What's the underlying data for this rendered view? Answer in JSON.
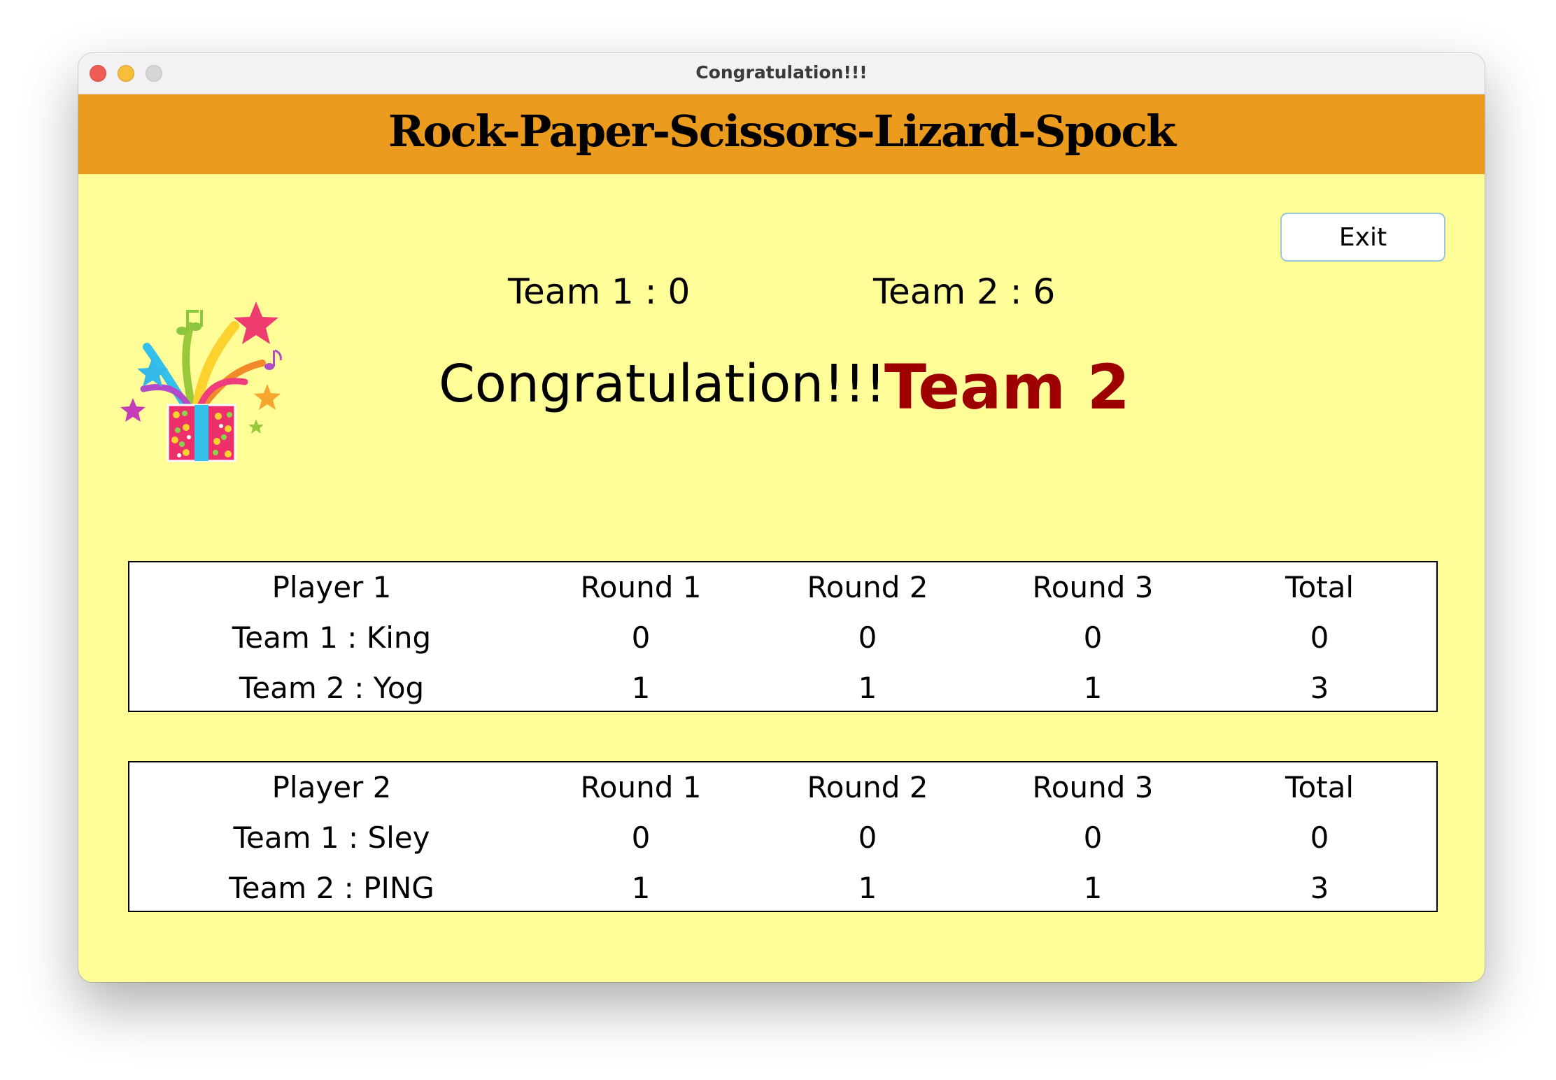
{
  "window": {
    "title": "Congratulation!!!"
  },
  "header": {
    "title": "Rock-Paper-Scissors-Lizard-Spock",
    "background_color": "#eb9b1d"
  },
  "body_color": "#fefd98",
  "exit_label": "Exit",
  "scores": {
    "team1": "Team 1 : 0",
    "team2": "Team 2 : 6"
  },
  "congrats_text": "Congratulation!!!",
  "winner_text": "Team 2",
  "winner_color": "#9e0000",
  "gift_icon": "gift-box-celebration-icon",
  "tables": [
    {
      "headers": [
        "Player 1",
        "Round 1",
        "Round 2",
        "Round 3",
        "Total"
      ],
      "rows": [
        [
          "Team 1 : King",
          "0",
          "0",
          "0",
          "0"
        ],
        [
          "Team 2 : Yog",
          "1",
          "1",
          "1",
          "3"
        ]
      ]
    },
    {
      "headers": [
        "Player 2",
        "Round 1",
        "Round 2",
        "Round 3",
        "Total"
      ],
      "rows": [
        [
          "Team 1 : Sley",
          "0",
          "0",
          "0",
          "0"
        ],
        [
          "Team 2 : PING",
          "1",
          "1",
          "1",
          "3"
        ]
      ]
    }
  ]
}
